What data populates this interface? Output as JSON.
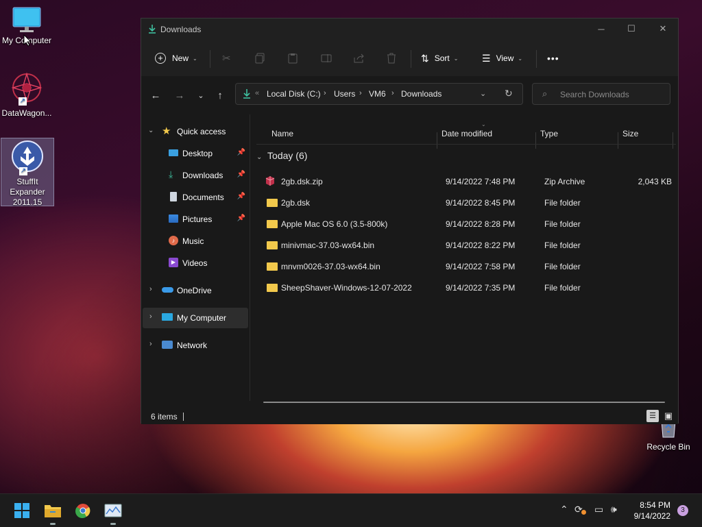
{
  "desktop": {
    "icons": [
      {
        "label": "My Computer"
      },
      {
        "label": "DataWagon..."
      },
      {
        "label": "StuffIt Expander 2011.15"
      },
      {
        "label": "Recycle Bin"
      }
    ]
  },
  "window": {
    "title": "Downloads",
    "toolbar": {
      "new_label": "New",
      "sort_label": "Sort",
      "view_label": "View",
      "more_label": "•••"
    },
    "breadcrumbs": [
      "Local Disk (C:)",
      "Users",
      "VM6",
      "Downloads"
    ],
    "search_placeholder": "Search Downloads",
    "sidebar": {
      "quick_access": "Quick access",
      "items": [
        {
          "label": "Desktop",
          "pinned": true
        },
        {
          "label": "Downloads",
          "pinned": true
        },
        {
          "label": "Documents",
          "pinned": true
        },
        {
          "label": "Pictures",
          "pinned": true
        },
        {
          "label": "Music",
          "pinned": false
        },
        {
          "label": "Videos",
          "pinned": false
        }
      ],
      "onedrive": "OneDrive",
      "my_computer": "My Computer",
      "network": "Network"
    },
    "columns": [
      "Name",
      "Date modified",
      "Type",
      "Size"
    ],
    "group_label": "Today (6)",
    "files": [
      {
        "name": "2gb.dsk.zip",
        "date": "9/14/2022 7:48 PM",
        "type": "Zip Archive",
        "size": "2,043 KB",
        "icon": "zip-archive-icon"
      },
      {
        "name": "2gb.dsk",
        "date": "9/14/2022 8:45 PM",
        "type": "File folder",
        "size": "",
        "icon": "folder-icon"
      },
      {
        "name": "Apple Mac OS 6.0 (3.5-800k)",
        "date": "9/14/2022 8:28 PM",
        "type": "File folder",
        "size": "",
        "icon": "folder-icon"
      },
      {
        "name": "minivmac-37.03-wx64.bin",
        "date": "9/14/2022 8:22 PM",
        "type": "File folder",
        "size": "",
        "icon": "folder-icon"
      },
      {
        "name": "mnvm0026-37.03-wx64.bin",
        "date": "9/14/2022 7:58 PM",
        "type": "File folder",
        "size": "",
        "icon": "folder-icon"
      },
      {
        "name": "SheepShaver-Windows-12-07-2022",
        "date": "9/14/2022 7:35 PM",
        "type": "File folder",
        "size": "",
        "icon": "folder-icon"
      }
    ],
    "status": "6 items"
  },
  "taskbar": {
    "time": "8:54 PM",
    "date": "9/14/2022",
    "notifications": "3"
  },
  "colors": {
    "accent_folder": "#f2c94c",
    "selection": "#2d2d2d",
    "window_bg": "#191919"
  }
}
